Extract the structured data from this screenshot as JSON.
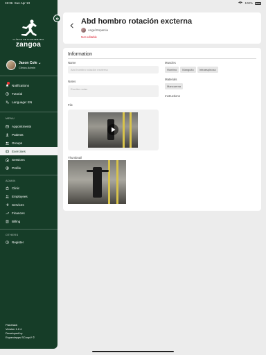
{
  "status": {
    "time": "15:36",
    "date": "Sun Apr 13",
    "battery": "100%"
  },
  "sidebar": {
    "logo": {
      "subtitle": "CLÍNICA DE FISIOTERAPIA",
      "brand": "zangoa"
    },
    "profile": {
      "name": "Jason Cole",
      "role": "Clinics Admin"
    },
    "top_items": [
      {
        "label": "Notifications",
        "icon": "bell-icon"
      },
      {
        "label": "Tutorial",
        "icon": "play-circle-icon"
      },
      {
        "label": "Language: EN",
        "icon": "translate-icon"
      }
    ],
    "menu_title": "MENU",
    "menu_items": [
      {
        "label": "Appointments",
        "icon": "calendar-icon"
      },
      {
        "label": "Patients",
        "icon": "patients-icon"
      },
      {
        "label": "Groups",
        "icon": "groups-icon"
      },
      {
        "label": "Exercises",
        "icon": "exercises-icon"
      },
      {
        "label": "Sessions",
        "icon": "sessions-icon"
      },
      {
        "label": "Profile",
        "icon": "profile-icon"
      }
    ],
    "admin_title": "ADMIN",
    "admin_items": [
      {
        "label": "Clinic",
        "icon": "clinic-icon"
      },
      {
        "label": "Employees",
        "icon": "employees-icon"
      },
      {
        "label": "Services",
        "icon": "services-icon"
      },
      {
        "label": "Finances",
        "icon": "finances-icon"
      },
      {
        "label": "Billing",
        "icon": "billing-icon"
      }
    ],
    "others_title": "OTHERS",
    "other_items": [
      {
        "label": "Register",
        "icon": "register-icon"
      }
    ],
    "footer": {
      "app": "Fisiotrack",
      "version": "Version 1.2.4",
      "developed": "Developed by",
      "dev_name": "Esparciapps SCoopV ©"
    }
  },
  "header": {
    "title": "Abd hombro rotación excterna",
    "author": "Angel Esparcia",
    "status": "Not editable"
  },
  "info": {
    "title": "Information",
    "name_label": "Name",
    "name_value": "Abd hombro rotación excterna",
    "notes_label": "Notes",
    "notes_placeholder": "Escribe notas",
    "file_label": "File",
    "thumbnail_label": "Thumbnail",
    "muscles_label": "Muscles",
    "muscles": [
      "Hombro",
      "Manguito",
      "Infraespinoso"
    ],
    "materials_label": "Materials",
    "materials": [
      "Mancuerna"
    ],
    "instructions_label": "Instructions"
  },
  "colors": {
    "sidebar": "#163d28",
    "active_bg": "#f2f2f2",
    "danger": "#dd2233"
  }
}
